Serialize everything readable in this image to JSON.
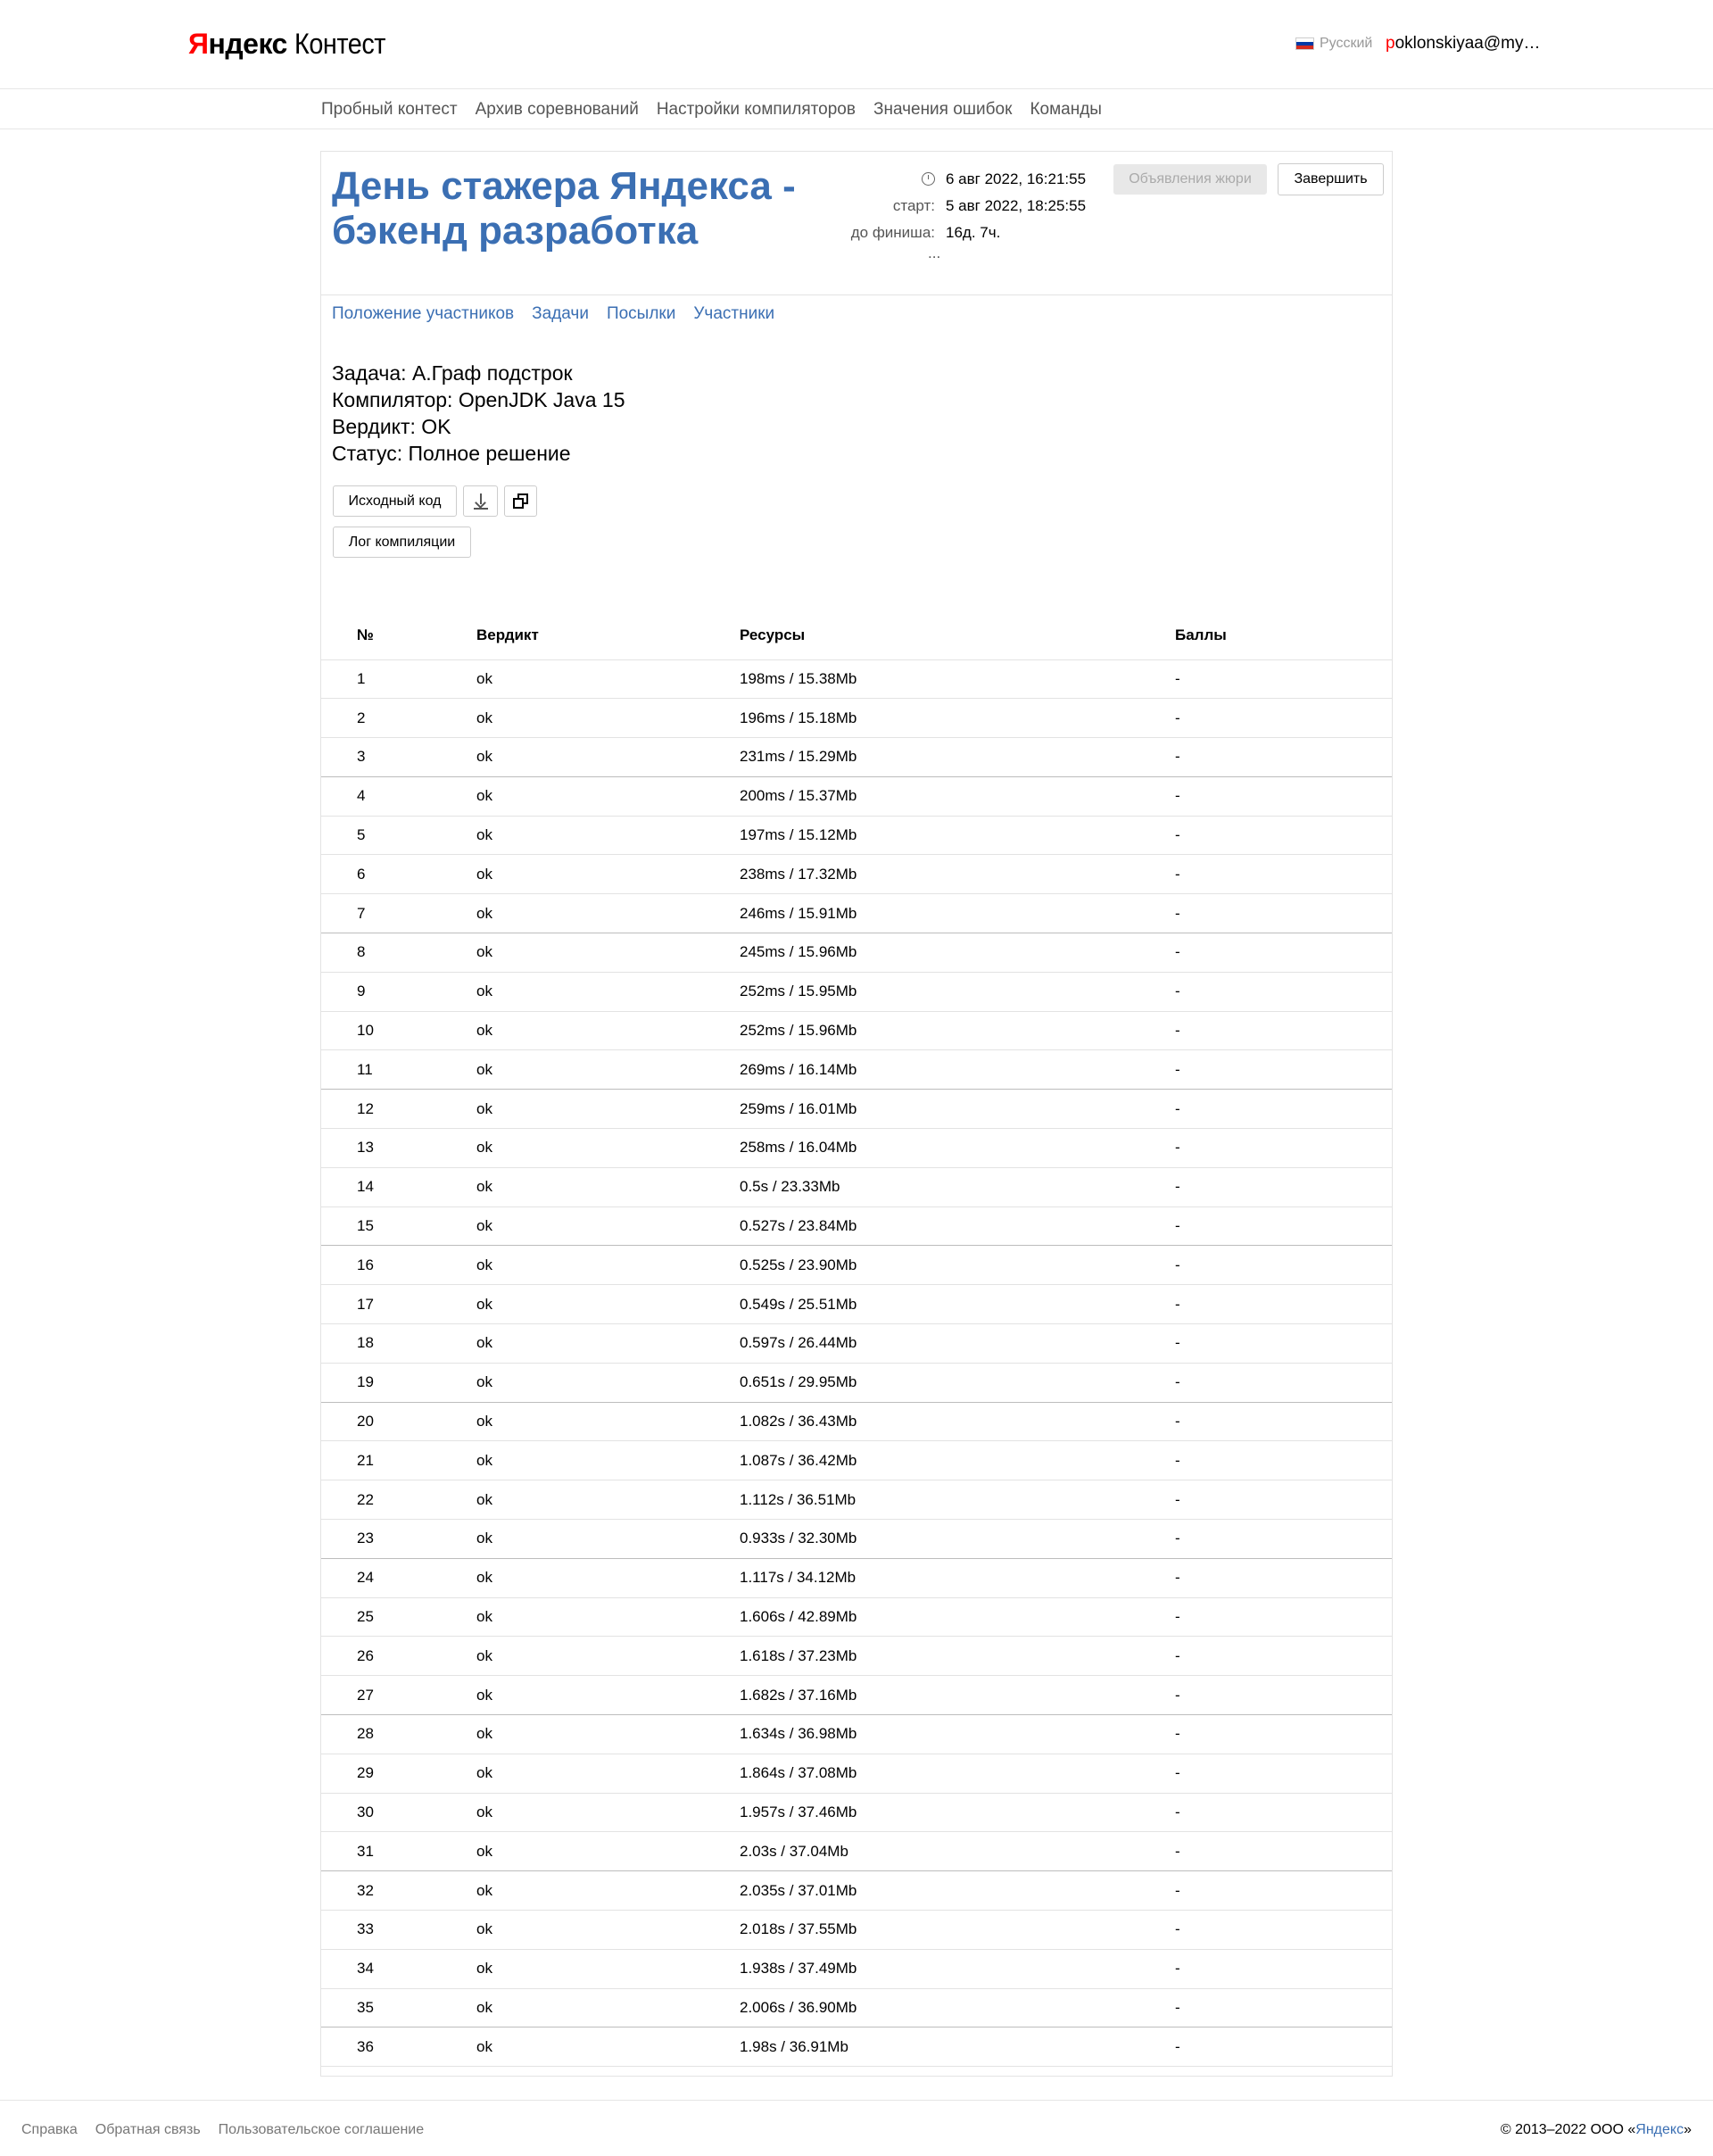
{
  "header": {
    "logo_first": "Я",
    "logo_rest": "ндекс",
    "logo_product": "Контест",
    "lang": "Русский",
    "user_first": "p",
    "user_rest": "oklonskiyaa@my…"
  },
  "nav": [
    "Пробный контест",
    "Архив соревнований",
    "Настройки компиляторов",
    "Значения ошибок",
    "Команды"
  ],
  "contest": {
    "title": "День стажера Яндекса - бэкенд разработка",
    "current_time": "6 авг 2022, 16:21:55",
    "start_label": "старт:",
    "start_value": "5 авг 2022, 18:25:55",
    "finish_label": "до финиша:",
    "finish_value": "16д. 7ч.",
    "ellipsis": "...",
    "jury_button": "Объявления жюри",
    "finish_button": "Завершить"
  },
  "tabs": [
    "Положение участников",
    "Задачи",
    "Посылки",
    "Участники"
  ],
  "submission": {
    "task": "Задача: A.Граф подстрок",
    "compiler": "Компилятор: OpenJDK Java 15",
    "verdict": "Вердикт: OK",
    "status": "Статус: Полное решение",
    "source_button": "Исходный код",
    "log_button": "Лог компиляции"
  },
  "table": {
    "headers": [
      "№",
      "Вердикт",
      "Ресурсы",
      "Баллы"
    ],
    "rows": [
      [
        "1",
        "ok",
        "198ms / 15.38Mb",
        "-"
      ],
      [
        "2",
        "ok",
        "196ms / 15.18Mb",
        "-"
      ],
      [
        "3",
        "ok",
        "231ms / 15.29Mb",
        "-"
      ],
      [
        "4",
        "ok",
        "200ms / 15.37Mb",
        "-"
      ],
      [
        "5",
        "ok",
        "197ms / 15.12Mb",
        "-"
      ],
      [
        "6",
        "ok",
        "238ms / 17.32Mb",
        "-"
      ],
      [
        "7",
        "ok",
        "246ms / 15.91Mb",
        "-"
      ],
      [
        "8",
        "ok",
        "245ms / 15.96Mb",
        "-"
      ],
      [
        "9",
        "ok",
        "252ms / 15.95Mb",
        "-"
      ],
      [
        "10",
        "ok",
        "252ms / 15.96Mb",
        "-"
      ],
      [
        "11",
        "ok",
        "269ms / 16.14Mb",
        "-"
      ],
      [
        "12",
        "ok",
        "259ms / 16.01Mb",
        "-"
      ],
      [
        "13",
        "ok",
        "258ms / 16.04Mb",
        "-"
      ],
      [
        "14",
        "ok",
        "0.5s / 23.33Mb",
        "-"
      ],
      [
        "15",
        "ok",
        "0.527s / 23.84Mb",
        "-"
      ],
      [
        "16",
        "ok",
        "0.525s / 23.90Mb",
        "-"
      ],
      [
        "17",
        "ok",
        "0.549s / 25.51Mb",
        "-"
      ],
      [
        "18",
        "ok",
        "0.597s / 26.44Mb",
        "-"
      ],
      [
        "19",
        "ok",
        "0.651s / 29.95Mb",
        "-"
      ],
      [
        "20",
        "ok",
        "1.082s / 36.43Mb",
        "-"
      ],
      [
        "21",
        "ok",
        "1.087s / 36.42Mb",
        "-"
      ],
      [
        "22",
        "ok",
        "1.112s / 36.51Mb",
        "-"
      ],
      [
        "23",
        "ok",
        "0.933s / 32.30Mb",
        "-"
      ],
      [
        "24",
        "ok",
        "1.117s / 34.12Mb",
        "-"
      ],
      [
        "25",
        "ok",
        "1.606s / 42.89Mb",
        "-"
      ],
      [
        "26",
        "ok",
        "1.618s / 37.23Mb",
        "-"
      ],
      [
        "27",
        "ok",
        "1.682s / 37.16Mb",
        "-"
      ],
      [
        "28",
        "ok",
        "1.634s / 36.98Mb",
        "-"
      ],
      [
        "29",
        "ok",
        "1.864s / 37.08Mb",
        "-"
      ],
      [
        "30",
        "ok",
        "1.957s / 37.46Mb",
        "-"
      ],
      [
        "31",
        "ok",
        "2.03s / 37.04Mb",
        "-"
      ],
      [
        "32",
        "ok",
        "2.035s / 37.01Mb",
        "-"
      ],
      [
        "33",
        "ok",
        "2.018s / 37.55Mb",
        "-"
      ],
      [
        "34",
        "ok",
        "1.938s / 37.49Mb",
        "-"
      ],
      [
        "35",
        "ok",
        "2.006s / 36.90Mb",
        "-"
      ],
      [
        "36",
        "ok",
        "1.98s / 36.91Mb",
        "-"
      ]
    ]
  },
  "footer": {
    "links": [
      "Справка",
      "Обратная связь",
      "Пользовательское соглашение"
    ],
    "copyright": "© 2013–2022  ООО «",
    "company": "Яндекс",
    "copyright_end": "»"
  }
}
